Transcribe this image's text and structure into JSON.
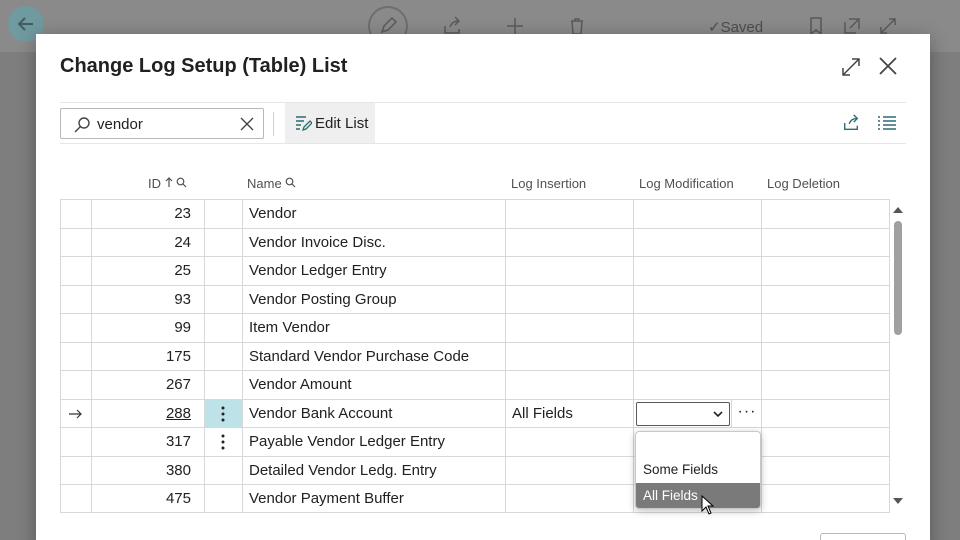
{
  "app_bar": {
    "saved_label": "Saved"
  },
  "dialog": {
    "title": "Change Log Setup (Table) List"
  },
  "toolbar": {
    "search_value": "vendor",
    "edit_list_label": "Edit List"
  },
  "columns": {
    "id": "ID",
    "name": "Name",
    "log_insertion": "Log Insertion",
    "log_modification": "Log Modification",
    "log_deletion": "Log Deletion"
  },
  "rows": [
    {
      "id": "23",
      "name": "Vendor",
      "log_insertion": ""
    },
    {
      "id": "24",
      "name": "Vendor Invoice Disc.",
      "log_insertion": ""
    },
    {
      "id": "25",
      "name": "Vendor Ledger Entry",
      "log_insertion": ""
    },
    {
      "id": "93",
      "name": "Vendor Posting Group",
      "log_insertion": ""
    },
    {
      "id": "99",
      "name": "Item Vendor",
      "log_insertion": ""
    },
    {
      "id": "175",
      "name": "Standard Vendor Purchase Code",
      "log_insertion": ""
    },
    {
      "id": "267",
      "name": "Vendor Amount",
      "log_insertion": ""
    },
    {
      "id": "288",
      "name": "Vendor Bank Account",
      "log_insertion": "All Fields"
    },
    {
      "id": "317",
      "name": "Payable Vendor Ledger Entry",
      "log_insertion": ""
    },
    {
      "id": "380",
      "name": "Detailed Vendor Ledg. Entry",
      "log_insertion": ""
    },
    {
      "id": "475",
      "name": "Vendor Payment Buffer",
      "log_insertion": ""
    }
  ],
  "dropdown": {
    "selected": "",
    "options": [
      "",
      "Some Fields",
      "All Fields"
    ],
    "highlighted": "All Fields"
  },
  "colors": {
    "selected_row_cell": "#bde2e8",
    "option_highlight": "#7a7a7a",
    "back_button": "#6f9aa0"
  },
  "icons": {
    "back": "arrow-left-icon",
    "edit": "pencil-icon",
    "share": "share-icon",
    "new": "plus-icon",
    "delete": "trash-icon",
    "bookmark": "bookmark-icon",
    "open_new": "open-in-new-icon",
    "expand": "expand-icon",
    "close": "close-icon",
    "search": "search-icon",
    "clear": "clear-icon",
    "edit_list": "edit-list-icon",
    "list_view": "list-view-icon",
    "row_arrow": "row-arrow-icon",
    "kebab": "kebab-icon",
    "sort": "sort-ascending-icon",
    "column_search": "column-search-icon"
  }
}
